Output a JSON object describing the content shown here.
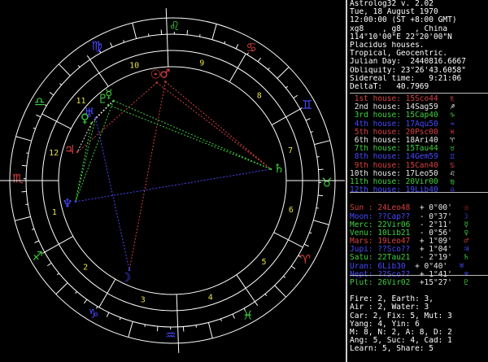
{
  "header": {
    "lines": [
      "Astrolog32 v. 2.02",
      "Tue, 18 August 1970",
      "12:00:00 (ST +8:00 GMT)",
      "xg8    , g8   , China",
      "114°10'00\"E 22°20'00\"N",
      "Placidus houses.",
      "Tropical, Geocentric.",
      "Julian Day:  2440816.6667",
      "Obliquity: 23°26'43.6058\"",
      "Sidereal time:   9:21:06",
      "DeltaT:   40.7969"
    ]
  },
  "houses": [
    {
      "name": "1st house:",
      "pos": "15Sco44",
      "glyph": "♏",
      "color": "#d84040"
    },
    {
      "name": "2nd house:",
      "pos": "14Sag59",
      "glyph": "♐",
      "color": "#e8e8e8"
    },
    {
      "name": "3rd house:",
      "pos": "15Cap40",
      "glyph": "♑",
      "color": "#40d040"
    },
    {
      "name": "4th house:",
      "pos": "17Aqu50",
      "glyph": "♒",
      "color": "#4848ff"
    },
    {
      "name": "5th house:",
      "pos": "20Psc00",
      "glyph": "♓",
      "color": "#d84040"
    },
    {
      "name": "6th house:",
      "pos": "18Ari40",
      "glyph": "♈",
      "color": "#e8e8e8"
    },
    {
      "name": "7th house:",
      "pos": "15Tau44",
      "glyph": "♉",
      "color": "#40d040"
    },
    {
      "name": "8th house:",
      "pos": "14Gem59",
      "glyph": "♊",
      "color": "#4848ff"
    },
    {
      "name": "9th house:",
      "pos": "15Can40",
      "glyph": "♋",
      "color": "#d84040"
    },
    {
      "name": "10th house:",
      "pos": "17Leo50",
      "glyph": "♌",
      "color": "#e8e8e8"
    },
    {
      "name": "11th house:",
      "pos": "20Vir00",
      "glyph": "♍",
      "color": "#40d040"
    },
    {
      "name": "12th house:",
      "pos": "19Lib40",
      "glyph": "♎",
      "color": "#4848ff"
    }
  ],
  "planets": [
    {
      "name": "Sun :",
      "pos": "24Leo48",
      "decl": "+ 0°00'",
      "glyph": "☉",
      "color": "#d84040"
    },
    {
      "name": "Moon:",
      "pos": "??Cap??",
      "decl": "- 0°37'",
      "glyph": "☽",
      "color": "#4848ff"
    },
    {
      "name": "Merc:",
      "pos": "22Vir06",
      "decl": "- 2°11'",
      "glyph": "☿",
      "color": "#40d040"
    },
    {
      "name": "Venu:",
      "pos": "10Lib21",
      "decl": "- 0°56'",
      "glyph": "♀",
      "color": "#40d040"
    },
    {
      "name": "Mars:",
      "pos": "19Leo47",
      "decl": "+ 1°09'",
      "glyph": "♂",
      "color": "#d84040"
    },
    {
      "name": "Jupi:",
      "pos": "??Sco??",
      "decl": "+ 1°04'",
      "glyph": "♃",
      "color": "#4848ff"
    },
    {
      "name": "Satu:",
      "pos": "22Tau21",
      "decl": "- 2°19'",
      "glyph": "♄",
      "color": "#40d040"
    },
    {
      "name": "Uran:",
      "pos": "6Lib30",
      "decl": "+ 0°40'",
      "glyph": "♅",
      "color": "#4848ff"
    },
    {
      "name": "Nept:",
      "pos": "??Sco??",
      "decl": "+ 1°41'",
      "glyph": "♆",
      "color": "#4848ff"
    },
    {
      "name": "Plut:",
      "pos": "26Vir02",
      "decl": "+15°27'",
      "glyph": "♇",
      "color": "#40d040"
    }
  ],
  "stats": [
    "Fire: 2, Earth: 3,",
    "Air : 2, Water: 3",
    "Car: 2, Fix: 5, Mut: 3",
    "Yang: 4, Yin: 6",
    "M: 8, N: 2, A: 8, D: 2",
    "Ang: 5, Suc: 4, Cad: 1",
    "Learn: 5, Share: 5"
  ],
  "chart_data": {
    "ascendant_deg": 225.73,
    "sign_glyphs": [
      "♈",
      "♉",
      "♊",
      "♋",
      "♌",
      "♍",
      "♎",
      "♏",
      "♐",
      "♑",
      "♒",
      "♓"
    ],
    "sign_colors": [
      "#d84040",
      "#40d040",
      "#4848ff",
      "#d84040",
      "#40d040",
      "#4848ff",
      "#40d040",
      "#d84040",
      "#40d040",
      "#4848ff",
      "#4848ff",
      "#40d040"
    ],
    "house_cusps_deg": [
      225.73,
      254.98,
      285.67,
      317.83,
      350.0,
      18.67,
      45.73,
      74.98,
      105.67,
      137.83,
      170.0,
      198.67
    ],
    "house_numbers": [
      "1",
      "2",
      "3",
      "4",
      "5",
      "6",
      "7",
      "8",
      "9",
      "10",
      "11",
      "12"
    ],
    "planets": [
      {
        "key": "sun",
        "glyph": "☉",
        "deg": 144.8,
        "color": "#d84040"
      },
      {
        "key": "mars",
        "glyph": "♂",
        "deg": 139.78,
        "color": "#d84040"
      },
      {
        "key": "merc",
        "glyph": "☿",
        "deg": 172.1,
        "color": "#40d040"
      },
      {
        "key": "venu",
        "glyph": "♀",
        "deg": 190.35,
        "color": "#40d040"
      },
      {
        "key": "plut",
        "glyph": "♇",
        "deg": 176.03,
        "color": "#40d040"
      },
      {
        "key": "uran",
        "glyph": "♅",
        "deg": 186.5,
        "color": "#4848ff"
      },
      {
        "key": "jupi",
        "glyph": "♃",
        "deg": 209.0,
        "color": "#d84040"
      },
      {
        "key": "nept",
        "glyph": "♆",
        "deg": 238.0,
        "color": "#4848ff"
      },
      {
        "key": "moon",
        "glyph": "☽",
        "deg": 290.0,
        "color": "#4848ff"
      },
      {
        "key": "satu",
        "glyph": "♄",
        "deg": 52.35,
        "color": "#40d040"
      }
    ],
    "aspects": [
      {
        "a": "sun",
        "b": "satu",
        "color": "#d84040"
      },
      {
        "a": "mars",
        "b": "satu",
        "color": "#d84040"
      },
      {
        "a": "mars",
        "b": "moon",
        "color": "#d84040"
      },
      {
        "a": "sun",
        "b": "jupi",
        "color": "#d84040"
      },
      {
        "a": "merc",
        "b": "satu",
        "color": "#40d040"
      },
      {
        "a": "plut",
        "b": "satu",
        "color": "#40d040"
      },
      {
        "a": "merc",
        "b": "nept",
        "color": "#40d040"
      },
      {
        "a": "venu",
        "b": "nept",
        "color": "#40d040"
      },
      {
        "a": "uran",
        "b": "nept",
        "color": "#40d040"
      },
      {
        "a": "nept",
        "b": "satu",
        "color": "#4848ff"
      },
      {
        "a": "uran",
        "b": "moon",
        "color": "#4848ff"
      },
      {
        "a": "merc",
        "b": "uran",
        "color": "#e8e8e8"
      },
      {
        "a": "venu",
        "b": "jupi",
        "color": "#e8e8e8"
      },
      {
        "a": "merc",
        "b": "venu",
        "color": "#e8e8e8"
      }
    ]
  }
}
